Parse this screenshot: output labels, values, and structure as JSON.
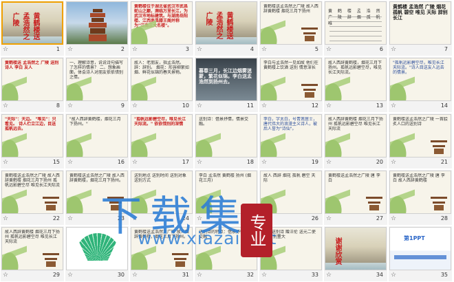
{
  "slides": [
    {
      "num": "1",
      "style": "rock",
      "title": "黄鹤楼送孟浩然之广陵"
    },
    {
      "num": "2",
      "style": "tower",
      "title": ""
    },
    {
      "num": "3",
      "style": "text-red",
      "title": "黄鹤楼位于湖北省武汉市武昌蛇山之巅，濒临万里长江，为武汉市地标建筑。与湖南岳阳楼、江西南昌滕王阁并称为\"江南三大名楼\"。"
    },
    {
      "num": "4",
      "style": "rock",
      "title": "黄鹤楼送孟浩然之广陵"
    },
    {
      "num": "5",
      "style": "poem",
      "title": "黄鹤楼送孟浩然之广陵 故人西辞黄鹤楼 烟花三月下扬州"
    },
    {
      "num": "6",
      "style": "pinyin",
      "title": "黄 鹤 楼 孟 浩 然 广 陵 辞 烟 孤 帆 唯"
    },
    {
      "num": "7",
      "style": "text-dark",
      "title": "黄鹤楼 孟浩然 广陵 烟花 孤帆 碧空 唯见 天际 辞别 长江"
    },
    {
      "num": "8",
      "style": "text-red",
      "title": "黄鹤楼送 孟浩然之 广陵 送别 诗人 李白 友人"
    },
    {
      "num": "9",
      "style": "text",
      "title": "一、理解诗意，说说诗句描写了怎样的情景？ 二、想象画面，体会诗人对朋友依依惜别之情。"
    },
    {
      "num": "10",
      "style": "text",
      "title": "故人：老朋友，指孟浩然。 辞：辞别。 烟花：形容柳絮如烟、鲜花似锦的春天景物。"
    },
    {
      "num": "11",
      "style": "dark",
      "title": "暮春三月，长江边烟雾迷蒙，繁花似锦。李白送孟浩然到扬州去。"
    },
    {
      "num": "12",
      "style": "poem",
      "title": "李白与孟浩然一见如故 他们在黄鹤楼上饮酒 送别 情意深长"
    },
    {
      "num": "13",
      "style": "text",
      "title": "故人西辞黄鹤楼，烟花三月下扬州。孤帆远影碧空尽，唯见长江天际流。"
    },
    {
      "num": "14",
      "style": "text-blue",
      "title": "\"孤帆远影碧空尽，唯见长江天际流。\"诗人目送友人远去的情景。"
    },
    {
      "num": "15",
      "style": "text-red",
      "title": "\"天际\"：天边。 \"唯见\"：只看见。 诗人伫立江边，目送孤帆远去。"
    },
    {
      "num": "16",
      "style": "text",
      "title": "\"故人西辞黄鹤楼，烟花三月下扬州。\""
    },
    {
      "num": "17",
      "style": "text-red",
      "title": "\"孤帆远影碧空尽，唯见长江天际流。\" 依依惜别的深情"
    },
    {
      "num": "18",
      "style": "text",
      "title": "送别诗：借景抒情，情景交融。"
    },
    {
      "num": "19",
      "style": "text-blue",
      "title": "李白，字太白，号青莲居士，唐代伟大的浪漫主义诗人，被后人誉为\"诗仙\"。"
    },
    {
      "num": "20",
      "style": "text",
      "title": "故人西辞黄鹤楼 烟花三月下扬州 孤帆远影碧空尽 唯见长江天际流"
    },
    {
      "num": "21",
      "style": "poem",
      "title": "黄鹤楼送孟浩然之广陵 一首脍炙人口的送别诗"
    },
    {
      "num": "22",
      "style": "poem",
      "title": "黄鹤楼送孟浩然之广陵 故人西辞黄鹤楼 烟花三月下扬州 孤帆远影碧空尽 唯见长江天际流"
    },
    {
      "num": "23",
      "style": "poem",
      "title": "黄鹤楼送孟浩然之广陵 故人西辞黄鹤楼，烟花三月下扬州。"
    },
    {
      "num": "24",
      "style": "text",
      "title": "送别地点 送别时间 送别对象 送别方式"
    },
    {
      "num": "25",
      "style": "text",
      "title": "李白 孟浩然 黄鹤楼 扬州 (烟花三月)"
    },
    {
      "num": "26",
      "style": "text",
      "title": "故人 西辞 烟花 孤帆 碧空 天际"
    },
    {
      "num": "27",
      "style": "poem",
      "title": "黄鹤楼送孟浩然之广陵 唐 李白"
    },
    {
      "num": "28",
      "style": "poem",
      "title": "黄鹤楼送孟浩然之广陵 唐 李白 故人西辞黄鹤楼"
    },
    {
      "num": "29",
      "style": "poem",
      "title": "故人西辞黄鹤楼 烟花三月下扬州 孤帆远影碧空尽 唯见长江天际流"
    },
    {
      "num": "30",
      "style": "fan",
      "title": ""
    },
    {
      "num": "31",
      "style": "poem",
      "title": "黄鹤楼送孟浩然之广陵 故人西辞黄鹤楼，烟花三月下扬州。"
    },
    {
      "num": "32",
      "style": "text",
      "title": "送别诗的特点：借景抒情 情景交融"
    },
    {
      "num": "33",
      "style": "text",
      "title": "同是送别诗 赠汪伦 送元二使安西 别董大"
    },
    {
      "num": "34",
      "style": "rock",
      "title": "谢谢欣赏"
    },
    {
      "num": "35",
      "style": "ppt",
      "title": "第1PPT"
    }
  ],
  "watermark": {
    "big": "下载集",
    "url": "www.xiazai.net",
    "badge": "专业"
  },
  "colors": {
    "selected_border": "#f0a000",
    "accent_red": "#c81d1d",
    "watermark_blue": "#2f7fd6",
    "badge_red": "#b3202a"
  }
}
